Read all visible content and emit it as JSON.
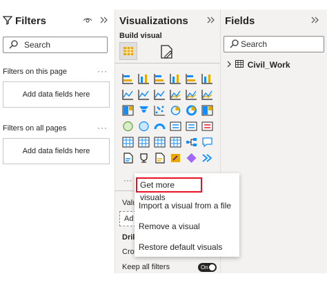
{
  "filters": {
    "title": "Filters",
    "search_placeholder": "Search",
    "on_this_page": "Filters on this page",
    "on_all_pages": "Filters on all pages",
    "add_fields_page": "Add data fields here",
    "add_fields_all": "Add data fields here",
    "more": "···"
  },
  "visualizations": {
    "title": "Visualizations",
    "build_visual": "Build visual",
    "more_dots": "···",
    "partial_values": "Valu",
    "partial_add": "Ad",
    "partial_drill": "Dril",
    "partial_cross": "Cro",
    "keep_all_filters": "Keep all filters",
    "toggle_state": "On"
  },
  "context_menu": {
    "items": [
      "Get more visuals",
      "Import a visual from a file",
      "Remove a visual",
      "Restore default visuals"
    ]
  },
  "fields": {
    "title": "Fields",
    "search_placeholder": "Search",
    "table_name": "Civil_Work"
  },
  "colors": {
    "accent": "#118dff",
    "highlight": "#e81123",
    "icon_yellow": "#e8a900"
  }
}
